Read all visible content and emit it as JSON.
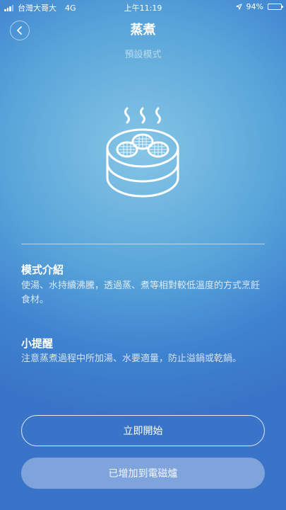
{
  "status_bar": {
    "carrier": "台灣大哥大",
    "network": "4G",
    "time": "上午11:19",
    "battery": "94%",
    "battery_level": 0.94
  },
  "header": {
    "title": "蒸煮",
    "subtitle": "預設模式"
  },
  "icons": {
    "back": "chevron-left-icon",
    "illustration": "steamer-icon",
    "location": "location-arrow-icon"
  },
  "mode_intro": {
    "title": "模式介紹",
    "body": "使湯、水持續沸騰，透過蒸、煮等相對較低溫度的方式烹飪食材。"
  },
  "tips": {
    "title": "小提醒",
    "body": "注意蒸煮過程中所加湯、水要適量，防止溢鍋或乾鍋。"
  },
  "actions": {
    "start_label": "立即開始",
    "added_label": "已增加到電磁爐"
  }
}
